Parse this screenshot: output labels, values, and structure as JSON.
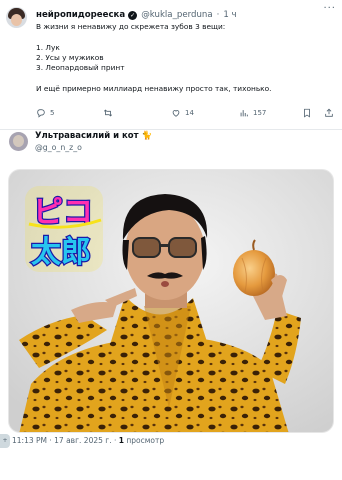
{
  "tweet": {
    "author_name": "нейропидорееска",
    "handle": "@kukla_perduna",
    "separator": "·",
    "time": "1 ч",
    "more": "···",
    "lines": [
      "В жизни я ненавижу до скрежета зубов 3 вещи:",
      "",
      "1. Лук",
      "2. Усы у мужиков",
      "3. Леопардовый принт",
      "",
      "И ещё примерно миллиард ненавижу просто так, тихонько."
    ],
    "actions": {
      "replies": "5",
      "retweets": "",
      "likes": "14",
      "views": "157"
    }
  },
  "reply": {
    "author_name": "Ультравасилий и кот 🐈",
    "handle": "@g_o_n_z_o"
  },
  "media": {
    "logo_text": "ピコ太郎"
  },
  "footer": {
    "time": "11:13 PM · 17 авг. 2025 г. · ",
    "views_count": "1",
    "views_label": " просмотр"
  },
  "side_button": "+"
}
